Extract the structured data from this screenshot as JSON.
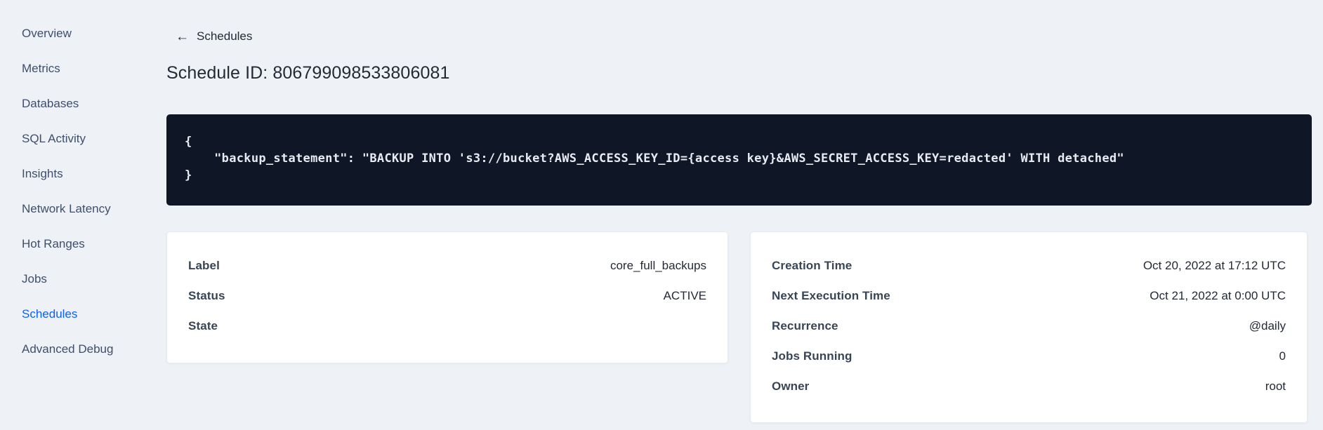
{
  "sidebar": {
    "items": [
      {
        "label": "Overview",
        "active": false
      },
      {
        "label": "Metrics",
        "active": false
      },
      {
        "label": "Databases",
        "active": false
      },
      {
        "label": "SQL Activity",
        "active": false
      },
      {
        "label": "Insights",
        "active": false
      },
      {
        "label": "Network Latency",
        "active": false
      },
      {
        "label": "Hot Ranges",
        "active": false
      },
      {
        "label": "Jobs",
        "active": false
      },
      {
        "label": "Schedules",
        "active": true
      },
      {
        "label": "Advanced Debug",
        "active": false
      }
    ]
  },
  "header": {
    "back_label": "Schedules",
    "title": "Schedule ID: 806799098533806081"
  },
  "icons": {
    "back_arrow": "←"
  },
  "code_block": {
    "text": "{\n    \"backup_statement\": \"BACKUP INTO 's3://bucket?AWS_ACCESS_KEY_ID={access key}&AWS_SECRET_ACCESS_KEY=redacted' WITH detached\"\n}"
  },
  "schedule_card": {
    "rows": [
      {
        "label": "Label",
        "value": "core_full_backups"
      },
      {
        "label": "Status",
        "value": "ACTIVE"
      },
      {
        "label": "State",
        "value": ""
      }
    ]
  },
  "execution_card": {
    "rows": [
      {
        "label": "Creation Time",
        "value": "Oct 20, 2022 at 17:12 UTC"
      },
      {
        "label": "Next Execution Time",
        "value": "Oct 21, 2022 at 0:00 UTC"
      },
      {
        "label": "Recurrence",
        "value": "@daily"
      },
      {
        "label": "Jobs Running",
        "value": "0"
      },
      {
        "label": "Owner",
        "value": "root"
      }
    ]
  },
  "colors": {
    "page_bg": "#eef2f6",
    "code_bg": "#0f1626",
    "accent_blue": "#0b5fff"
  }
}
